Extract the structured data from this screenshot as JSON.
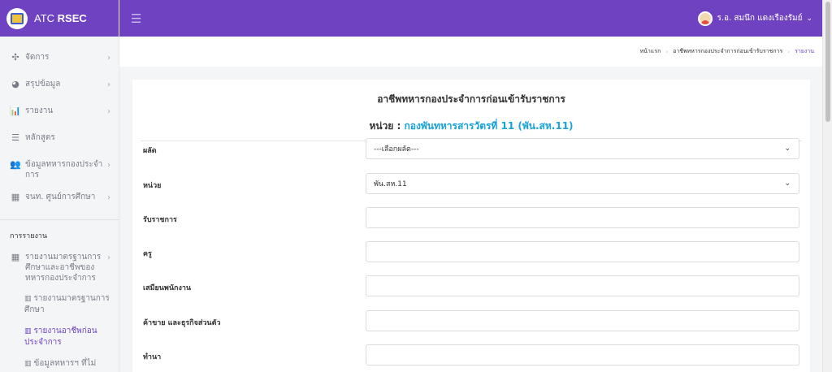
{
  "brand": {
    "name_prefix": "ATC",
    "name_strong": "RSEC"
  },
  "topbar": {
    "user_name": "ร.อ. สมนึก แดงเรืองรัมย์"
  },
  "sidebar": {
    "items": [
      {
        "icon": "move-icon",
        "glyph": "✣",
        "label": "จัดการ",
        "chevron": "›"
      },
      {
        "icon": "pie-chart-icon",
        "glyph": "◕",
        "label": "สรุปข้อมูล",
        "chevron": "›"
      },
      {
        "icon": "bar-chart-icon",
        "glyph": "📊",
        "label": "รายงาน",
        "chevron": "›"
      },
      {
        "icon": "list-icon",
        "glyph": "☰",
        "label": "หลักสูตร",
        "chevron": ""
      },
      {
        "icon": "users-icon",
        "glyph": "👥",
        "label": "ข้อมูลทหารกองประจำการ",
        "chevron": "›"
      },
      {
        "icon": "grid-icon",
        "glyph": "▦",
        "label": "จนท. ศูนย์การศึกษา",
        "chevron": "›"
      }
    ],
    "section_heading": "การรายงาน",
    "report_group": {
      "icon": "grid-icon",
      "glyph": "▦",
      "label": "รายงานมาตรฐานการศึกษาและอาชีพของทหารกองประจำการ",
      "chevron": "›"
    },
    "sub_items": [
      {
        "label": "รายงานมาตรฐานการศึกษา",
        "active": false
      },
      {
        "label": "รายงานอาชีพก่อนประจำการ",
        "active": true
      },
      {
        "label": "ข้อมูลทหารฯ ที่ไม่",
        "active": false
      }
    ]
  },
  "breadcrumb": {
    "home": "หน้าแรก",
    "parent": "อาชีพทหารกองประจำการก่อนเข้ารับราชการ",
    "current": "รายงาน"
  },
  "card": {
    "title": "อาชีพทหารกองประจำการก่อนเข้ารับราชการ",
    "unit_label": "หน่วย : ",
    "unit_value": "กองพันทหารสารวัตรที่ 11 (พัน.สห.11)"
  },
  "form": {
    "fields": [
      {
        "label": "ผลัด",
        "type": "select",
        "value": "---เลือกผลัด---"
      },
      {
        "label": "หน่วย",
        "type": "select",
        "value": "พัน.สห.11"
      },
      {
        "label": "รับราชการ",
        "type": "text",
        "value": ""
      },
      {
        "label": "ครู",
        "type": "text",
        "value": ""
      },
      {
        "label": "เสมียนพนักงาน",
        "type": "text",
        "value": ""
      },
      {
        "label": "ค้าขาย และธุรกิจส่วนตัว",
        "type": "text",
        "value": ""
      },
      {
        "label": "ทำนา",
        "type": "text",
        "value": ""
      }
    ]
  },
  "colors": {
    "primary": "#6f42c1",
    "accent_link": "#17a2d8",
    "sidebar_bg": "#f4f5f7"
  }
}
